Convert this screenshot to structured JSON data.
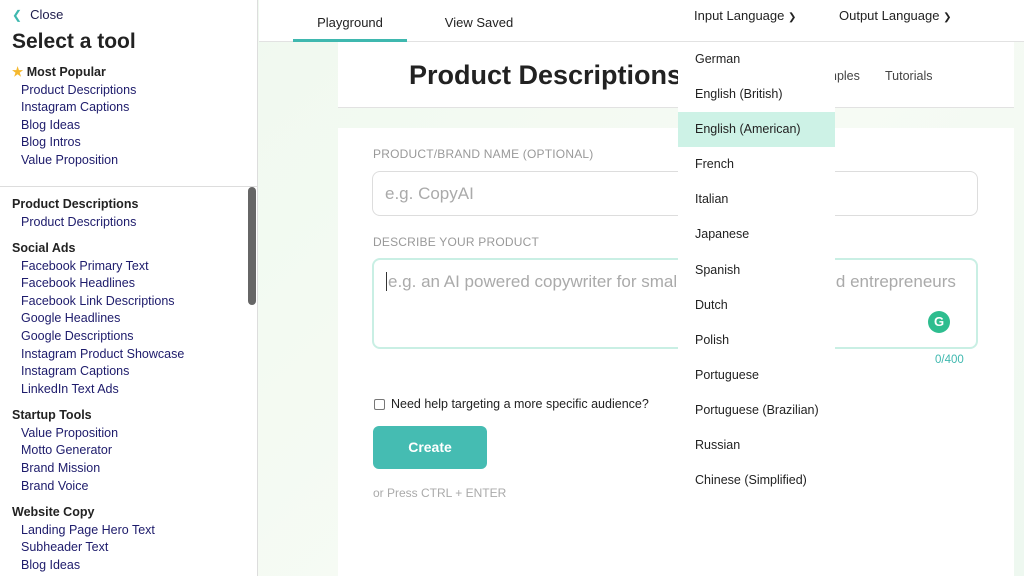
{
  "sidebar": {
    "close_label": "Close",
    "title": "Select a tool",
    "most_popular": {
      "label": "Most Popular",
      "icon": "star-icon",
      "items": [
        "Product Descriptions",
        "Instagram Captions",
        "Blog Ideas",
        "Blog Intros",
        "Value Proposition"
      ]
    },
    "categories": [
      {
        "label": "Product Descriptions",
        "items": [
          "Product Descriptions"
        ]
      },
      {
        "label": "Social Ads",
        "items": [
          "Facebook Primary Text",
          "Facebook Headlines",
          "Facebook Link Descriptions",
          "Google Headlines",
          "Google Descriptions",
          "Instagram Product Showcase",
          "Instagram Captions",
          "LinkedIn Text Ads"
        ]
      },
      {
        "label": "Startup Tools",
        "items": [
          "Value Proposition",
          "Motto Generator",
          "Brand Mission",
          "Brand Voice"
        ]
      },
      {
        "label": "Website Copy",
        "items": [
          "Landing Page Hero Text",
          "Subheader Text",
          "Blog Ideas"
        ]
      }
    ]
  },
  "topbar": {
    "tabs": [
      "Playground",
      "View Saved"
    ],
    "active_tab": "Playground",
    "input_language": "Input Language",
    "output_language": "Output Language"
  },
  "header": {
    "title": "Product Descriptions",
    "links": [
      "Examples",
      "Tutorials"
    ]
  },
  "form": {
    "name_label": "PRODUCT/BRAND NAME (OPTIONAL)",
    "name_placeholder": "e.g. CopyAI",
    "describe_label": "DESCRIBE YOUR PRODUCT",
    "describe_placeholder": "e.g. an AI powered copywriter for small business owners and entrepreneurs",
    "counter": "0/400",
    "checkbox_label": "Need help targeting a more specific audience?",
    "checkbox_checked": false,
    "create_label": "Create",
    "hint": "or Press CTRL + ENTER"
  },
  "language_dropdown": {
    "options": [
      "German",
      "English (British)",
      "English (American)",
      "French",
      "Italian",
      "Japanese",
      "Spanish",
      "Dutch",
      "Polish",
      "Portuguese",
      "Portuguese (Brazilian)",
      "Russian",
      "Chinese (Simplified)"
    ],
    "selected": "English (American)",
    "highlight_color": "#cdf2e6"
  },
  "colors": {
    "accent": "#45bcb2"
  }
}
